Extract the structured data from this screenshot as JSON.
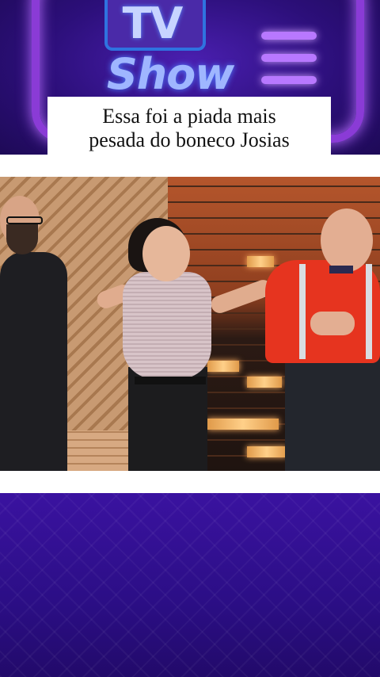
{
  "logo": {
    "tv": "TV",
    "show": "Show",
    "accent": "#8a3bd6"
  },
  "caption": {
    "line1": "Essa foi a piada mais",
    "line2": "pesada do boneco Josias"
  },
  "video": {
    "scene": "video-frame"
  },
  "colors": {
    "background": "#2a0f6e",
    "strip": "#ffffff"
  }
}
